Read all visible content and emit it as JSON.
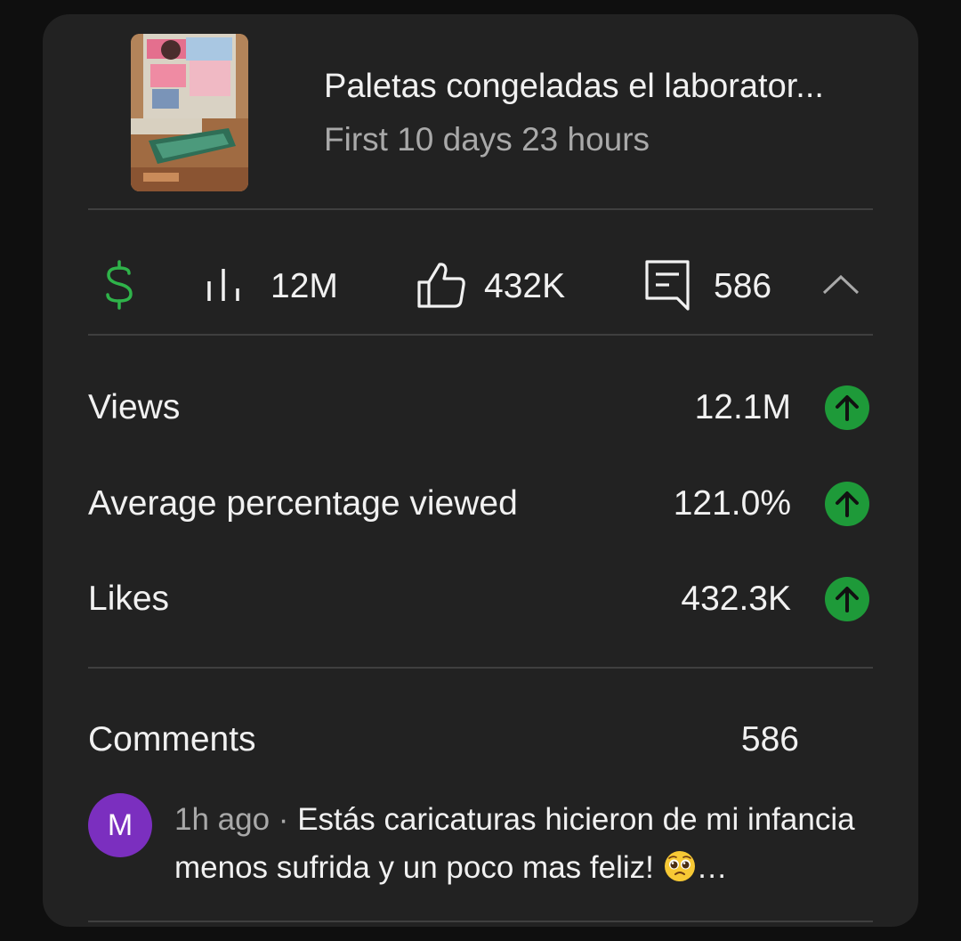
{
  "video": {
    "title": "Paletas congeladas el laborator...",
    "subtitle": "First 10 days 23 hours"
  },
  "stats_bar": {
    "monetization_icon": "dollar-icon",
    "views_icon": "bar-chart-icon",
    "views": "12M",
    "likes_icon": "thumbs-up-icon",
    "likes": "432K",
    "comments_icon": "comment-icon",
    "comments": "586",
    "collapse_icon": "chevron-up-icon"
  },
  "metrics": [
    {
      "label": "Views",
      "value": "12.1M",
      "trend": "up"
    },
    {
      "label": "Average percentage viewed",
      "value": "121.0%",
      "trend": "up"
    },
    {
      "label": "Likes",
      "value": "432.3K",
      "trend": "up"
    }
  ],
  "comments_section": {
    "label": "Comments",
    "count": "586",
    "latest": {
      "avatar_letter": "M",
      "time": "1h ago",
      "separator": "·",
      "text": "Estás caricaturas hicieron de mi infancia menos sufrida y un poco mas feliz!",
      "ellipsis": "…"
    }
  },
  "colors": {
    "background": "#0f0f0f",
    "card": "#222222",
    "accent_green": "#1e9a39",
    "dollar_green": "#2fb34a",
    "avatar": "#7b2fbf",
    "divider": "#3f3f3f",
    "secondary_text": "#a9a9a9"
  }
}
